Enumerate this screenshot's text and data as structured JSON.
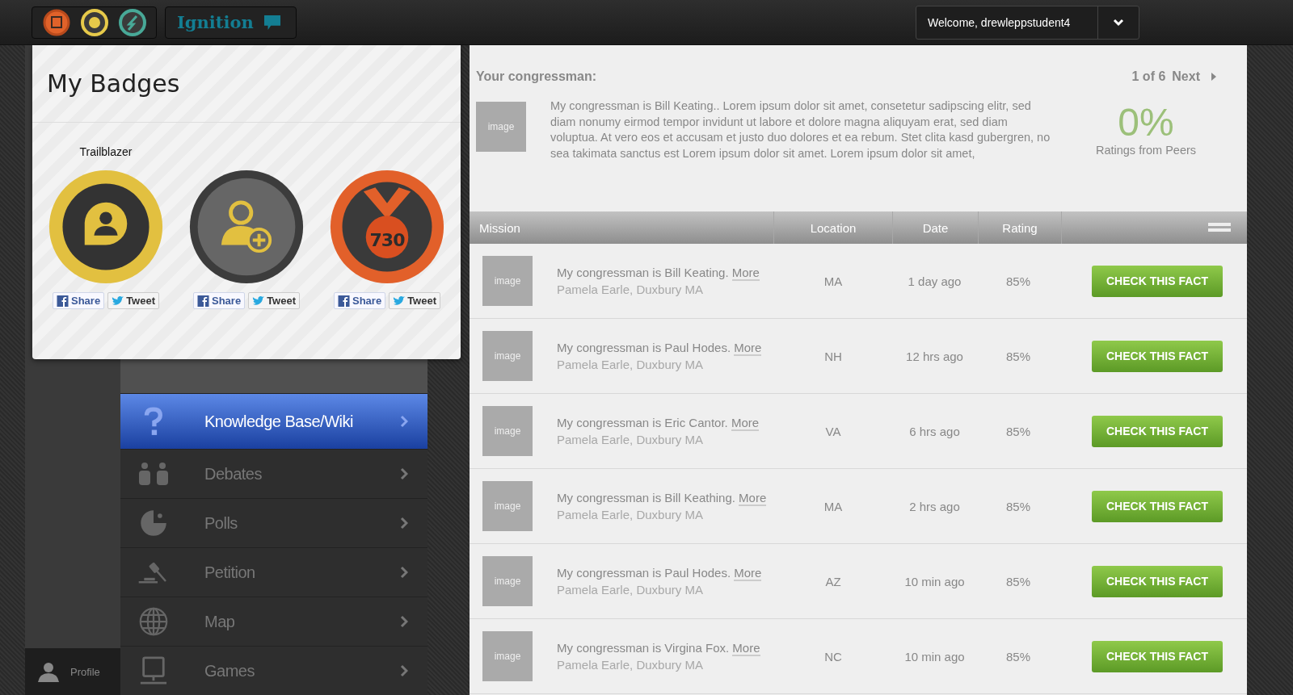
{
  "topbar": {
    "app_name": "Ignition",
    "welcome": "Welcome, drewleppstudent4"
  },
  "badges_panel": {
    "title": "My Badges",
    "badges": [
      {
        "label": "Trailblazer",
        "share": "Share",
        "tweet": "Tweet"
      },
      {
        "share": "Share",
        "tweet": "Tweet"
      },
      {
        "number": "730",
        "share": "Share",
        "tweet": "Tweet"
      }
    ]
  },
  "sidebar": {
    "items": [
      {
        "label": "Knowledge Base/Wiki",
        "selected": true
      },
      {
        "label": "Debates",
        "selected": false
      },
      {
        "label": "Polls",
        "selected": false
      },
      {
        "label": "Petition",
        "selected": false
      },
      {
        "label": "Map",
        "selected": false
      },
      {
        "label": "Games",
        "selected": false
      }
    ],
    "profile": "Profile"
  },
  "congressman": {
    "heading": "Your congressman:",
    "pager": "1 of 6",
    "next": "Next",
    "image": "image",
    "text": "My congressman is Bill Keating.. Lorem ipsum dolor sit amet, consetetur sadipscing elitr, sed diam nonumy eirmod tempor invidunt ut labore et dolore magna aliquyam erat, sed diam voluptua. At vero eos et accusam et justo duo dolores et ea rebum. Stet clita kasd gubergren, no sea takimata sanctus est Lorem ipsum dolor sit amet. Lorem ipsum dolor sit amet,",
    "rating": "0%",
    "rating_label": "Ratings from Peers"
  },
  "table": {
    "columns": [
      "Mission",
      "Location",
      "Date",
      "Rating"
    ],
    "rows": [
      {
        "image": "image",
        "mission": "My congressman is Bill Keating.",
        "more": "More",
        "author": "Pamela Earle, Duxbury MA",
        "location": "MA",
        "date": "1 day ago",
        "rating": "85%",
        "action": "CHECK THIS FACT"
      },
      {
        "image": "image",
        "mission": "My congressman is Paul Hodes.",
        "more": "More",
        "author": "Pamela Earle, Duxbury MA",
        "location": "NH",
        "date": "12 hrs ago",
        "rating": "85%",
        "action": "CHECK THIS FACT"
      },
      {
        "image": "image",
        "mission": "My congressman is Eric Cantor.",
        "more": "More",
        "author": "Pamela Earle, Duxbury MA",
        "location": "VA",
        "date": "6 hrs ago",
        "rating": "85%",
        "action": "CHECK THIS FACT"
      },
      {
        "image": "image",
        "mission": "My congressman is Bill Keathing.",
        "more": "More",
        "author": "Pamela Earle, Duxbury MA",
        "location": "MA",
        "date": "2 hrs ago",
        "rating": "85%",
        "action": "CHECK THIS FACT"
      },
      {
        "image": "image",
        "mission": "My congressman is Paul Hodes.",
        "more": "More",
        "author": "Pamela Earle, Duxbury MA",
        "location": "AZ",
        "date": "10 min ago",
        "rating": "85%",
        "action": "CHECK THIS FACT"
      },
      {
        "image": "image",
        "mission": "My congressman is Virgina Fox.",
        "more": "More",
        "author": "Pamela Earle, Duxbury MA",
        "location": "NC",
        "date": "10 min ago",
        "rating": "85%",
        "action": "CHECK THIS FACT"
      }
    ]
  }
}
